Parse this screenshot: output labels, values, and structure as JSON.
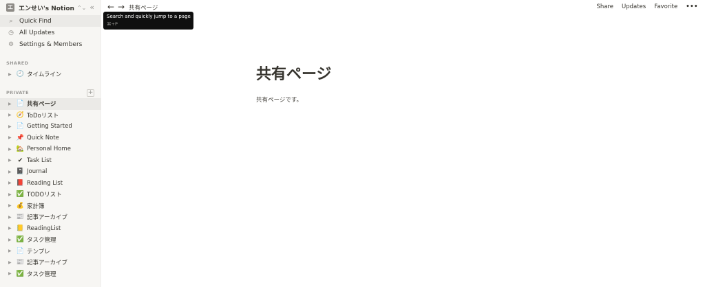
{
  "workspace": {
    "logo": "エ",
    "name": "エンせい's Notion",
    "switch_icon": "⌃⌄",
    "collapse_icon": "«"
  },
  "nav": [
    {
      "icon": "search-icon",
      "glyph": "⌕",
      "label": "Quick Find",
      "active": true
    },
    {
      "icon": "clock-icon",
      "glyph": "◷",
      "label": "All Updates",
      "active": false
    },
    {
      "icon": "gear-icon",
      "glyph": "⚙",
      "label": "Settings & Members",
      "active": false
    }
  ],
  "sections": {
    "shared_label": "SHARED",
    "private_label": "PRIVATE",
    "add_glyph": "+"
  },
  "shared_pages": [
    {
      "icon": "clock-face-icon",
      "glyph": "🕘",
      "label": "タイムライン"
    }
  ],
  "private_pages": [
    {
      "icon": "document-icon",
      "glyph": "📄",
      "label": "共有ページ",
      "selected": true
    },
    {
      "icon": "compass-icon",
      "glyph": "🧭",
      "label": "ToDoリスト"
    },
    {
      "icon": "document-icon",
      "glyph": "📄",
      "label": "Getting Started"
    },
    {
      "icon": "pushpin-icon",
      "glyph": "📌",
      "label": "Quick Note"
    },
    {
      "icon": "house-icon",
      "glyph": "🏡",
      "label": "Personal Home"
    },
    {
      "icon": "checkmark-icon",
      "glyph": "✔",
      "label": "Task List"
    },
    {
      "icon": "notebook-icon",
      "glyph": "📓",
      "label": "Journal"
    },
    {
      "icon": "book-icon",
      "glyph": "📕",
      "label": "Reading List"
    },
    {
      "icon": "green-check-icon",
      "glyph": "✅",
      "label": "TODOリスト"
    },
    {
      "icon": "money-bag-icon",
      "glyph": "💰",
      "label": "家計簿"
    },
    {
      "icon": "newspaper-icon",
      "glyph": "📰",
      "label": "記事アーカイブ"
    },
    {
      "icon": "notepad-icon",
      "glyph": "📒",
      "label": "ReadingList"
    },
    {
      "icon": "green-check-icon",
      "glyph": "✅",
      "label": "タスク管理"
    },
    {
      "icon": "document-icon",
      "glyph": "📄",
      "label": "テンプレ"
    },
    {
      "icon": "newspaper-icon",
      "glyph": "📰",
      "label": "記事アーカイブ"
    },
    {
      "icon": "green-check-icon",
      "glyph": "✅",
      "label": "タスク管理"
    }
  ],
  "topbar": {
    "back_glyph": "←",
    "forward_glyph": "→",
    "breadcrumb": "共有ページ",
    "share": "Share",
    "updates": "Updates",
    "favorite": "Favorite",
    "more": "•••"
  },
  "tooltip": {
    "title": "Search and quickly jump to a page",
    "shortcut": "⌘+P"
  },
  "page": {
    "title": "共有ページ",
    "body": "共有ページです。"
  },
  "colors": {
    "sidebar_bg": "#f7f6f3",
    "active_bg": "#ebeae7",
    "text": "#37352f",
    "muted": "#9b9a97",
    "tooltip_bg": "#0f0f0f"
  }
}
